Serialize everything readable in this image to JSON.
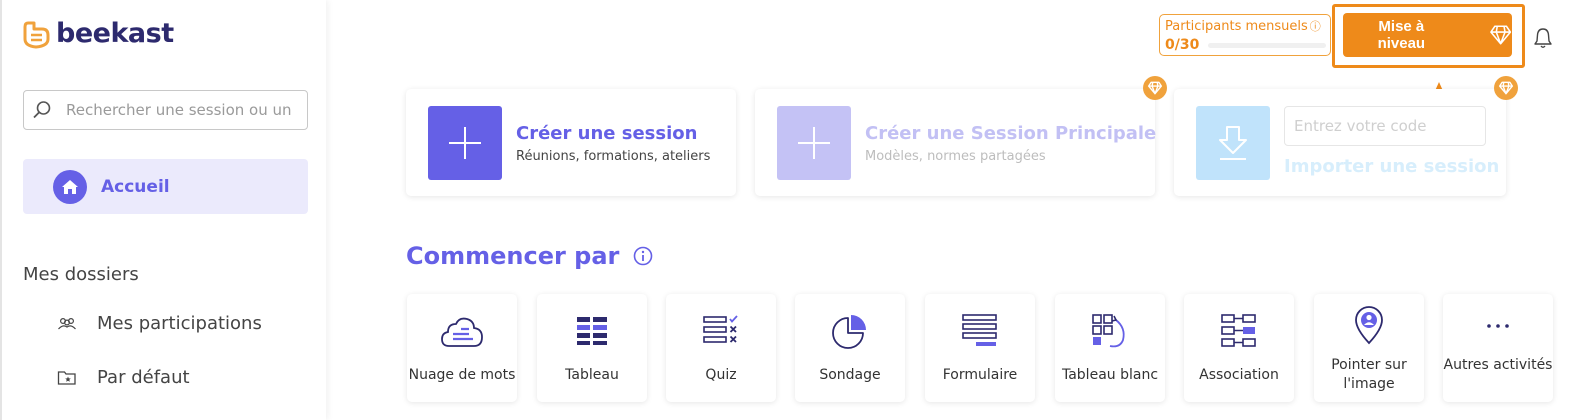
{
  "brand": {
    "name": "beekast",
    "color": "#2d2a6e",
    "accent": "#f0a23c"
  },
  "sidebar": {
    "search_placeholder": "Rechercher une session ou un",
    "home_label": "Accueil",
    "section_title": "Mes dossiers",
    "folders": [
      {
        "label": "Mes participations",
        "icon": "people-icon"
      },
      {
        "label": "Par défaut",
        "icon": "folder-star-icon"
      }
    ]
  },
  "header": {
    "participants_label": "Participants mensuels",
    "participants_count": "0/30",
    "upgrade_label": "Mise à niveau"
  },
  "cards": {
    "create_session": {
      "title": "Créer une session",
      "subtitle": "Réunions, formations, ateliers"
    },
    "create_main": {
      "title": "Créer une Session Principale",
      "subtitle": "Modèles, normes partagées"
    },
    "import": {
      "code_placeholder": "Entrez votre code",
      "label": "Importer une session"
    }
  },
  "start": {
    "title": "Commencer par",
    "activities": [
      {
        "label": "Nuage de mots",
        "icon": "cloud-icon"
      },
      {
        "label": "Tableau",
        "icon": "table-icon"
      },
      {
        "label": "Quiz",
        "icon": "quiz-icon"
      },
      {
        "label": "Sondage",
        "icon": "pie-chart-icon"
      },
      {
        "label": "Formulaire",
        "icon": "form-icon"
      },
      {
        "label": "Tableau blanc",
        "icon": "whiteboard-icon"
      },
      {
        "label": "Association",
        "icon": "association-icon"
      },
      {
        "label": "Pointer sur l'image",
        "icon": "map-pin-icon"
      },
      {
        "label": "Autres activités",
        "icon": "more-icon"
      }
    ]
  },
  "colors": {
    "primary": "#6560e6",
    "orange": "#ee8a1a"
  }
}
